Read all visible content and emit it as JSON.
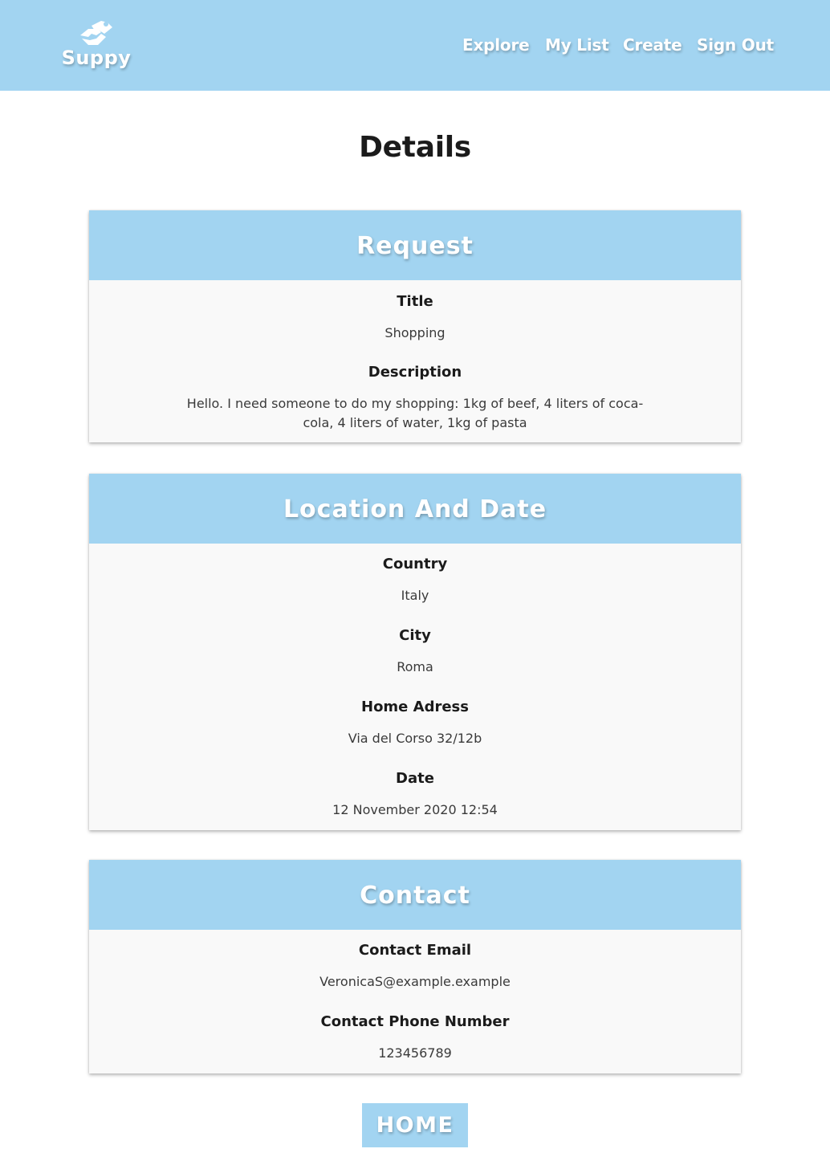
{
  "brand": {
    "name": "Suppy",
    "icon": "handshake-icon"
  },
  "nav": [
    {
      "label": "Explore"
    },
    {
      "label": "My List"
    },
    {
      "label": "Create"
    },
    {
      "label": "Sign Out"
    }
  ],
  "page": {
    "title": "Details"
  },
  "request": {
    "heading": "Request",
    "title_label": "Title",
    "title_value": "Shopping",
    "description_label": "Description",
    "description_value": "Hello. I need someone to do my shopping: 1kg of beef, 4 liters of coca-cola, 4 liters of water, 1kg of pasta"
  },
  "location": {
    "heading": "Location And Date",
    "country_label": "Country",
    "country_value": "Italy",
    "city_label": "City",
    "city_value": "Roma",
    "address_label": "Home Adress",
    "address_value": "Via del Corso 32/12b",
    "date_label": "Date",
    "date_value": "12 November 2020 12:54"
  },
  "contact": {
    "heading": "Contact",
    "email_label": "Contact Email",
    "email_value": "VeronicaS@example.example",
    "phone_label": "Contact Phone Number",
    "phone_value": "123456789"
  },
  "actions": {
    "home_label": "HOME"
  },
  "colors": {
    "accent": "#a2d4f1",
    "card_bg": "#f9f9f9",
    "text": "#1b1b1b"
  }
}
